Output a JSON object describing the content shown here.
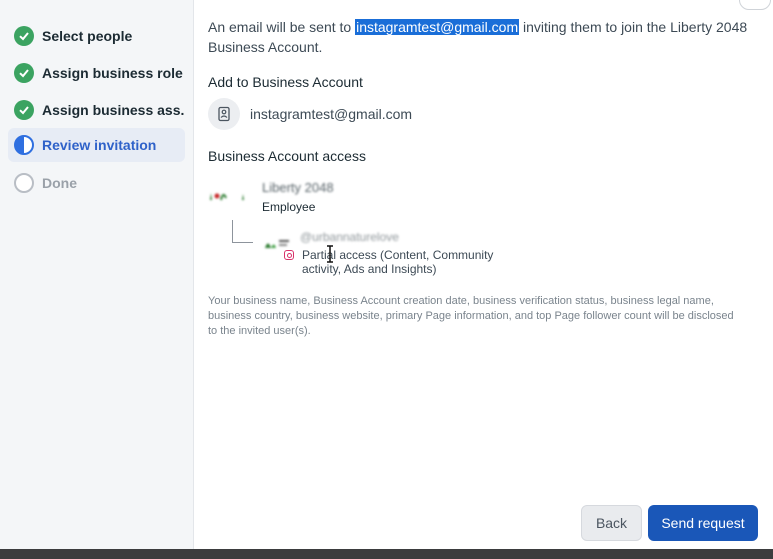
{
  "sidebar": {
    "steps": [
      {
        "label": "Select people",
        "state": "done"
      },
      {
        "label": "Assign business role",
        "state": "done"
      },
      {
        "label": "Assign business ass...",
        "state": "done"
      },
      {
        "label": "Review invitation",
        "state": "active"
      },
      {
        "label": "Done",
        "state": "pending"
      }
    ]
  },
  "intro": {
    "before": "An email will be sent to ",
    "email_highlight": "instagramtest@gmail.com",
    "after": " inviting them to join the Liberty 2048 Business Account."
  },
  "add_section": {
    "title": "Add to Business Account",
    "email": "instagramtest@gmail.com"
  },
  "access_section": {
    "title": "Business Account access",
    "account_name": "Liberty 2048",
    "account_role": "Employee",
    "asset_name": "@urbannaturelove",
    "asset_access": "Partial access (Content, Community activity, Ads and Insights)"
  },
  "disclaimer": "Your business name, Business Account creation date, business verification status, business legal name, business country, business website, primary Page information, and top Page follower count will be disclosed to the invited user(s).",
  "buttons": {
    "back": "Back",
    "send": "Send request"
  },
  "colors": {
    "accent": "#1a57b8",
    "done": "#3ba361",
    "highlight": "#1a6ed8"
  }
}
